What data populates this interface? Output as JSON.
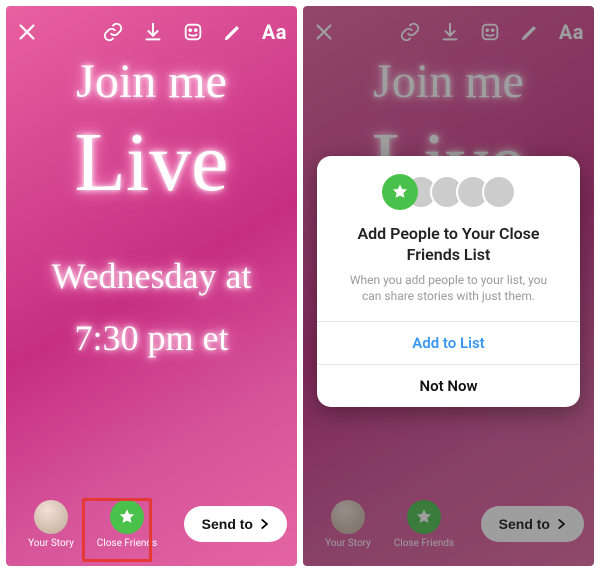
{
  "story": {
    "line1": "Join me",
    "line2": "Live",
    "line3": "Wednesday at",
    "line4": "7:30 pm et"
  },
  "toolbar": {
    "text_tool": "Aa"
  },
  "share": {
    "your_story": "Your Story",
    "close_friends": "Close Friends",
    "send_to": "Send to"
  },
  "modal": {
    "title": "Add People to Your Close Friends List",
    "body": "When you add people to your list, you can share stories with just them.",
    "primary": "Add to List",
    "secondary": "Not Now"
  }
}
